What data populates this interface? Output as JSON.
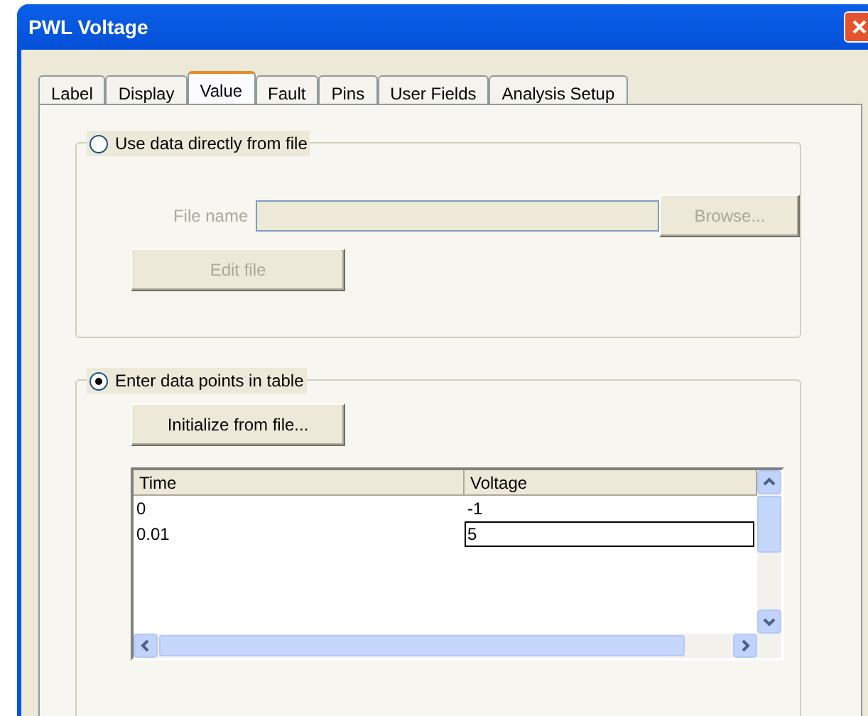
{
  "window": {
    "title": "PWL Voltage"
  },
  "tabs": [
    {
      "label": "Label",
      "selected": false
    },
    {
      "label": "Display",
      "selected": false
    },
    {
      "label": "Value",
      "selected": true
    },
    {
      "label": "Fault",
      "selected": false
    },
    {
      "label": "Pins",
      "selected": false
    },
    {
      "label": "User Fields",
      "selected": false
    },
    {
      "label": "Analysis Setup",
      "selected": false
    }
  ],
  "file_group": {
    "option": {
      "label": "Use data directly from file",
      "selected": false
    },
    "file_name_label": "File name",
    "file_name_field": {
      "disabled": true
    },
    "browse_button": {
      "label": "Browse...",
      "disabled": true
    },
    "edit_button": {
      "label": "Edit file",
      "disabled": true
    }
  },
  "table_group": {
    "option": {
      "label": "Enter data points in table",
      "selected": true
    },
    "init_button": {
      "label": "Initialize from file...",
      "disabled": false
    },
    "table": {
      "columns": [
        "Time",
        "Voltage"
      ],
      "rows": [
        {
          "time": "0",
          "voltage": "-1",
          "editing": false
        },
        {
          "time": "0.01",
          "voltage": "5",
          "editing": true
        }
      ]
    }
  }
}
